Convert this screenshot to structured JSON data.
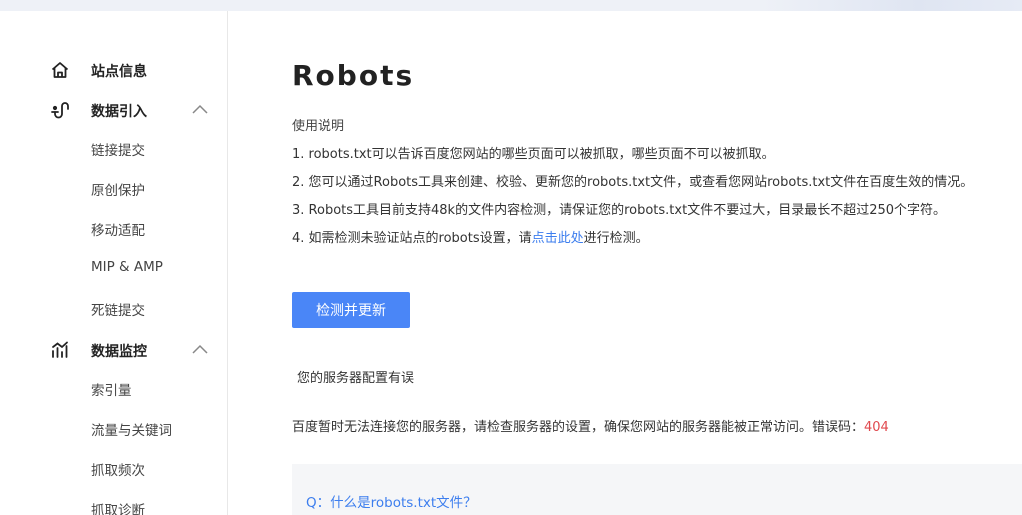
{
  "sidebar": {
    "groups": [
      {
        "label": "站点信息",
        "icon": "home-icon"
      },
      {
        "label": "数据引入",
        "icon": "data-import-icon",
        "expanded": true,
        "items": [
          "链接提交",
          "原创保护",
          "移动适配",
          "MIP & AMP",
          "死链提交"
        ]
      },
      {
        "label": "数据监控",
        "icon": "data-monitor-icon",
        "expanded": true,
        "items": [
          "索引量",
          "流量与关键词",
          "抓取频次",
          "抓取诊断"
        ]
      }
    ]
  },
  "main": {
    "title": "Robots",
    "instructions_title": "使用说明",
    "instructions": [
      "1. robots.txt可以告诉百度您网站的哪些页面可以被抓取，哪些页面不可以被抓取。",
      "2. 您可以通过Robots工具来创建、校验、更新您的robots.txt文件，或查看您网站robots.txt文件在百度生效的情况。",
      "3. Robots工具目前支持48k的文件内容检测，请保证您的robots.txt文件不要过大，目录最长不超过250个字符。"
    ],
    "instruction4": {
      "prefix": "4. 如需检测未验证站点的robots设置，请",
      "link": "点击此处",
      "suffix": "进行检测。"
    },
    "check_button": "检测并更新",
    "status_title": "您的服务器配置有误",
    "status_text": "百度暂时无法连接您的服务器，请检查服务器的设置，确保您网站的服务器能被正常访问。错误码：",
    "error_code": "404",
    "faq_question": "Q：什么是robots.txt文件？"
  },
  "colors": {
    "accent": "#4a86f7",
    "link": "#3d7eee",
    "error": "#e0494e"
  }
}
